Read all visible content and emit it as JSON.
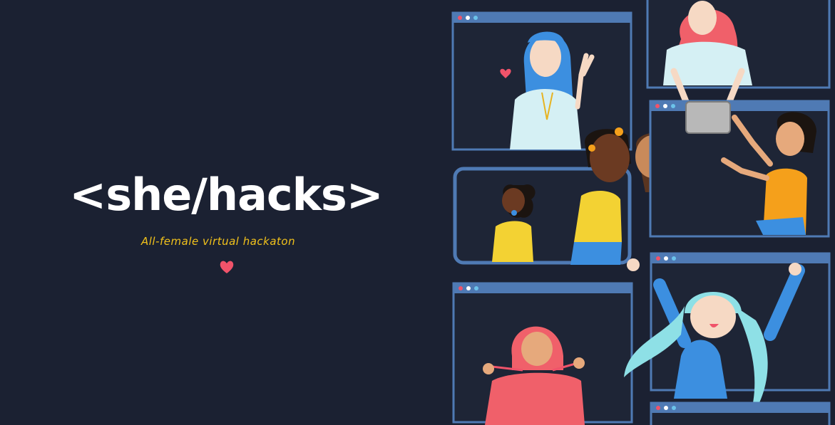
{
  "brand": {
    "logo_text": "<she/hacks>",
    "tagline": "All-female virtual hackaton"
  },
  "colors": {
    "background": "#1b2132",
    "accent_yellow": "#f2c21b",
    "heart_pink": "#f0536a",
    "window_frame": "#4f7ab4"
  },
  "icons": [
    "heart-icon"
  ]
}
